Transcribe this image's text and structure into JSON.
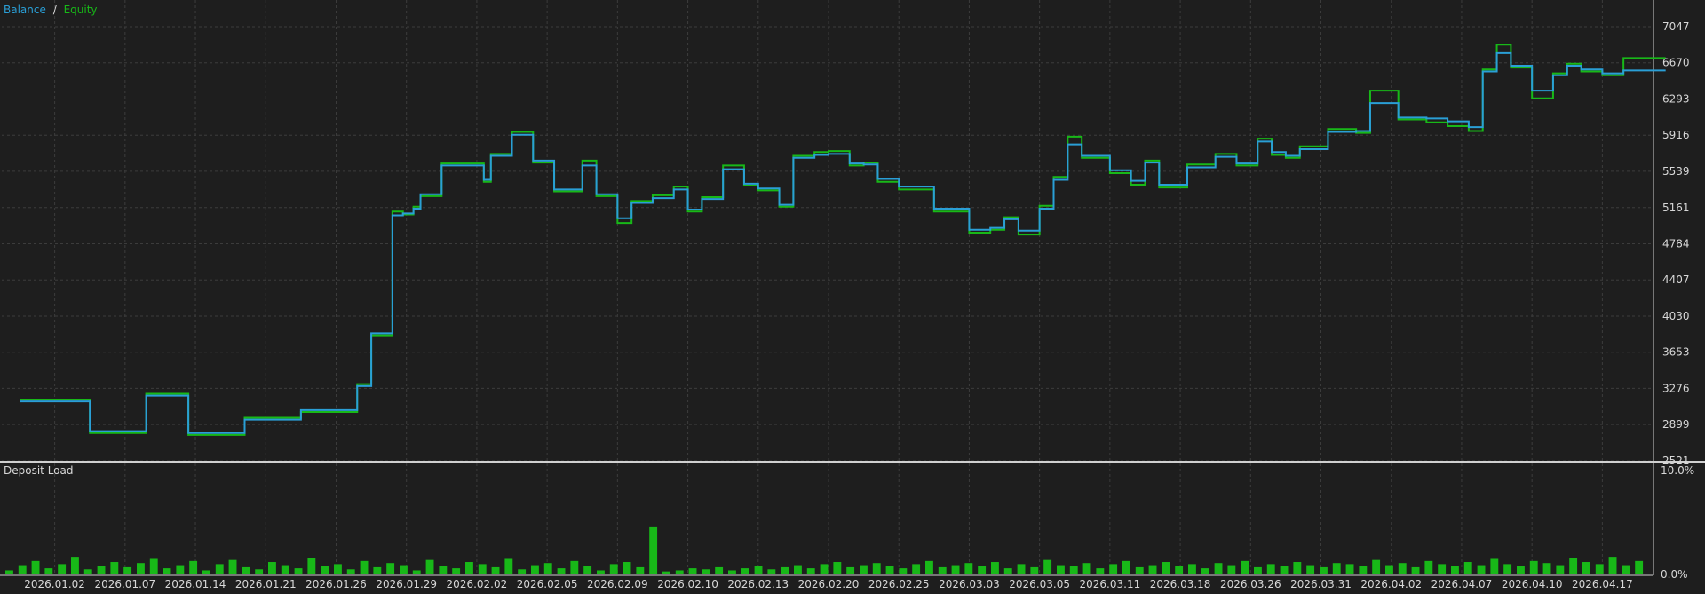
{
  "legend": {
    "balance_label": "Balance",
    "separator": "/",
    "equity_label": "Equity"
  },
  "deposit_panel": {
    "title": "Deposit Load",
    "max_label": "10.0%",
    "min_label": "0.0%"
  },
  "colors": {
    "background": "#1e1e1e",
    "grid": "#3c3c3c",
    "border": "#d0d0d0",
    "text": "#d8d8d8",
    "balance": "#2a9fd6",
    "equity": "#18b818",
    "deposit_load": "#18b818"
  },
  "chart_data": [
    {
      "type": "line",
      "title": "",
      "y_ticks": [
        7047,
        6670,
        6293,
        5916,
        5539,
        5161,
        4784,
        4407,
        4030,
        3653,
        3276,
        2899,
        2521
      ],
      "ylim": [
        2521,
        7047
      ],
      "x_ticks": [
        "2026.01.02",
        "2026.01.07",
        "2026.01.14",
        "2026.01.21",
        "2026.01.26",
        "2026.01.29",
        "2026.02.02",
        "2026.02.05",
        "2026.02.09",
        "2026.02.10",
        "2026.02.13",
        "2026.02.20",
        "2026.02.25",
        "2026.03.03",
        "2026.03.05",
        "2026.03.11",
        "2026.03.18",
        "2026.03.26",
        "2026.03.31",
        "2026.04.02",
        "2026.04.07",
        "2026.04.10",
        "2026.04.17"
      ],
      "grid": true,
      "series": [
        {
          "name": "Balance",
          "x": [
            0,
            1.0,
            1.8,
            2.4,
            3.2,
            4.0,
            4.8,
            5.0,
            5.3,
            5.45,
            5.6,
            5.7,
            6.0,
            6.6,
            6.7,
            7.0,
            7.3,
            7.6,
            8.0,
            8.2,
            8.5,
            8.7,
            9.0,
            9.3,
            9.5,
            9.7,
            10.0,
            10.3,
            10.5,
            10.8,
            11.0,
            11.3,
            11.5,
            11.8,
            12.0,
            12.2,
            12.5,
            13.0,
            13.5,
            13.8,
            14.0,
            14.2,
            14.5,
            14.7,
            14.9,
            15.1,
            15.5,
            15.8,
            16.0,
            16.2,
            16.6,
            17.0,
            17.3,
            17.6,
            17.8,
            18.0,
            18.2,
            18.6,
            19.0,
            19.2,
            19.6,
            20.0,
            20.3,
            20.6,
            20.8,
            21.0,
            21.2,
            21.5,
            21.8,
            22.0,
            22.2,
            22.5,
            22.8
          ],
          "values": [
            3140,
            2830,
            3200,
            2810,
            2950,
            3050,
            3300,
            3850,
            5080,
            5100,
            5150,
            5300,
            5600,
            5450,
            5700,
            5920,
            5650,
            5350,
            5600,
            5300,
            5050,
            5210,
            5260,
            5350,
            5140,
            5250,
            5560,
            5410,
            5360,
            5190,
            5680,
            5710,
            5720,
            5620,
            5610,
            5460,
            5380,
            5150,
            4930,
            4950,
            5040,
            4920,
            5150,
            5450,
            5820,
            5700,
            5550,
            5440,
            5630,
            5400,
            5580,
            5690,
            5620,
            5850,
            5740,
            5700,
            5770,
            5950,
            5960,
            6250,
            6100,
            6090,
            6060,
            6000,
            6580,
            6770,
            6640,
            6380,
            6540,
            6640,
            6600,
            6560,
            6590
          ]
        },
        {
          "name": "Equity",
          "x": [
            0,
            1.0,
            1.8,
            2.4,
            3.2,
            4.0,
            4.8,
            5.0,
            5.3,
            5.45,
            5.6,
            5.7,
            6.0,
            6.6,
            6.7,
            7.0,
            7.3,
            7.6,
            8.0,
            8.2,
            8.5,
            8.7,
            9.0,
            9.3,
            9.5,
            9.7,
            10.0,
            10.3,
            10.5,
            10.8,
            11.0,
            11.3,
            11.5,
            11.8,
            12.0,
            12.2,
            12.5,
            13.0,
            13.5,
            13.8,
            14.0,
            14.2,
            14.5,
            14.7,
            14.9,
            15.1,
            15.5,
            15.8,
            16.0,
            16.2,
            16.6,
            17.0,
            17.3,
            17.6,
            17.8,
            18.0,
            18.2,
            18.6,
            19.0,
            19.2,
            19.6,
            20.0,
            20.3,
            20.6,
            20.8,
            21.0,
            21.2,
            21.5,
            21.8,
            22.0,
            22.2,
            22.5,
            22.8
          ],
          "values": [
            3160,
            2810,
            3220,
            2790,
            2970,
            3030,
            3320,
            3830,
            5120,
            5090,
            5170,
            5280,
            5620,
            5430,
            5720,
            5950,
            5630,
            5330,
            5650,
            5280,
            5000,
            5230,
            5290,
            5380,
            5120,
            5270,
            5600,
            5390,
            5340,
            5170,
            5700,
            5740,
            5750,
            5600,
            5630,
            5430,
            5350,
            5120,
            4900,
            4930,
            5060,
            4880,
            5180,
            5480,
            5900,
            5680,
            5520,
            5400,
            5650,
            5370,
            5610,
            5720,
            5600,
            5880,
            5710,
            5680,
            5800,
            5980,
            5940,
            6380,
            6080,
            6050,
            6010,
            5960,
            6600,
            6860,
            6620,
            6300,
            6560,
            6660,
            6580,
            6540,
            6720
          ]
        }
      ]
    },
    {
      "type": "bar",
      "title": "Deposit Load",
      "ylim": [
        0,
        10
      ],
      "y_ticks": [
        "10.0%",
        "0.0%"
      ],
      "series": [
        {
          "name": "Deposit Load",
          "values": [
            0.3,
            0.8,
            1.2,
            0.5,
            0.9,
            1.6,
            0.4,
            0.7,
            1.1,
            0.6,
            1.0,
            1.4,
            0.5,
            0.8,
            1.2,
            0.3,
            0.9,
            1.3,
            0.6,
            0.4,
            1.1,
            0.8,
            0.5,
            1.5,
            0.7,
            0.9,
            0.4,
            1.2,
            0.6,
            1.0,
            0.8,
            0.3,
            1.3,
            0.7,
            0.5,
            1.1,
            0.9,
            0.6,
            1.4,
            0.4,
            0.8,
            1.0,
            0.5,
            1.2,
            0.7,
            0.3,
            0.9,
            1.1,
            0.6,
            4.5,
            0.2,
            0.3,
            0.5,
            0.4,
            0.6,
            0.3,
            0.5,
            0.7,
            0.4,
            0.6,
            0.8,
            0.5,
            0.9,
            1.1,
            0.6,
            0.8,
            1.0,
            0.7,
            0.5,
            0.9,
            1.2,
            0.6,
            0.8,
            1.0,
            0.7,
            1.1,
            0.5,
            0.9,
            0.6,
            1.3,
            0.8,
            0.7,
            1.0,
            0.5,
            0.9,
            1.2,
            0.6,
            0.8,
            1.1,
            0.7,
            0.9,
            0.5,
            1.0,
            0.8,
            1.2,
            0.6,
            0.9,
            0.7,
            1.1,
            0.8,
            0.6,
            1.0,
            0.9,
            0.7,
            1.3,
            0.8,
            1.0,
            0.6,
            1.2,
            0.9,
            0.7,
            1.1,
            0.8,
            1.4,
            0.9,
            0.7,
            1.2,
            1.0,
            0.8,
            1.5,
            1.1,
            0.9,
            1.6,
            0.8,
            1.2
          ]
        }
      ]
    }
  ]
}
